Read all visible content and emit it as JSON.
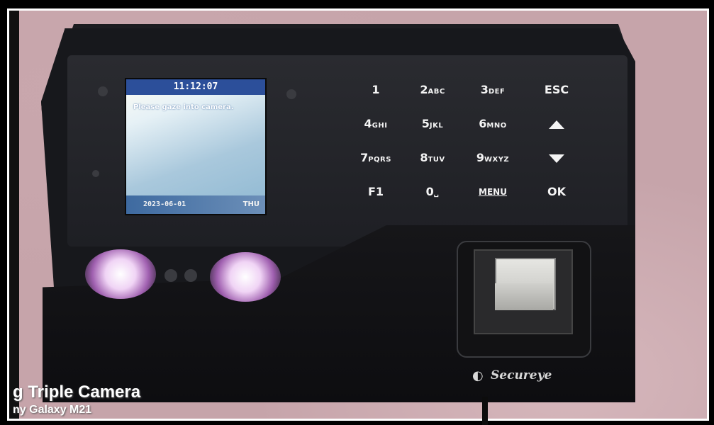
{
  "device_screen": {
    "time": "11:12:07",
    "message": "Please gaze into camera.",
    "date": "2023-06-01",
    "day": "THU"
  },
  "keypad": {
    "keys": [
      {
        "main": "1",
        "sub": ""
      },
      {
        "main": "2",
        "sub": "ABC"
      },
      {
        "main": "3",
        "sub": "DEF"
      },
      {
        "main": "ESC",
        "sub": ""
      },
      {
        "main": "4",
        "sub": "GHI"
      },
      {
        "main": "5",
        "sub": "JKL"
      },
      {
        "main": "6",
        "sub": "MNO"
      },
      {
        "main": "",
        "sub": "",
        "icon": "up-arrow-icon"
      },
      {
        "main": "7",
        "sub": "PQRS"
      },
      {
        "main": "8",
        "sub": "TUV"
      },
      {
        "main": "9",
        "sub": "WXYZ"
      },
      {
        "main": "",
        "sub": "",
        "icon": "down-arrow-icon"
      },
      {
        "main": "F1",
        "sub": ""
      },
      {
        "main": "0",
        "sub": "␣"
      },
      {
        "main": "MENU",
        "sub": ""
      },
      {
        "main": "OK",
        "sub": ""
      }
    ]
  },
  "brand": {
    "name": "Secureye"
  },
  "watermark": {
    "line1": "g Triple Camera",
    "line2": "ny Galaxy M21"
  }
}
